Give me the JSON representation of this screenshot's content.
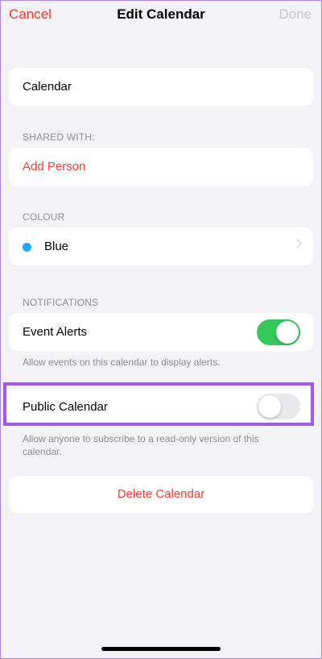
{
  "nav": {
    "cancel": "Cancel",
    "title": "Edit Calendar",
    "done": "Done"
  },
  "calendar_name": "Calendar",
  "shared_with": {
    "header": "SHARED WITH:",
    "add_person": "Add Person"
  },
  "colour": {
    "header": "COLOUR",
    "value": "Blue",
    "swatch": "#1fa8f5"
  },
  "notifications": {
    "header": "NOTIFICATIONS",
    "event_alerts_label": "Event Alerts",
    "event_alerts_on": true,
    "footer": "Allow events on this calendar to display alerts."
  },
  "public_calendar": {
    "label": "Public Calendar",
    "on": false,
    "footer": "Allow anyone to subscribe to a read-only version of this calendar."
  },
  "delete_label": "Delete Calendar",
  "colors": {
    "accent_red": "#ff3b30",
    "toggle_on": "#34c759",
    "highlight": "#a259e6",
    "background": "#f2f2f7"
  }
}
